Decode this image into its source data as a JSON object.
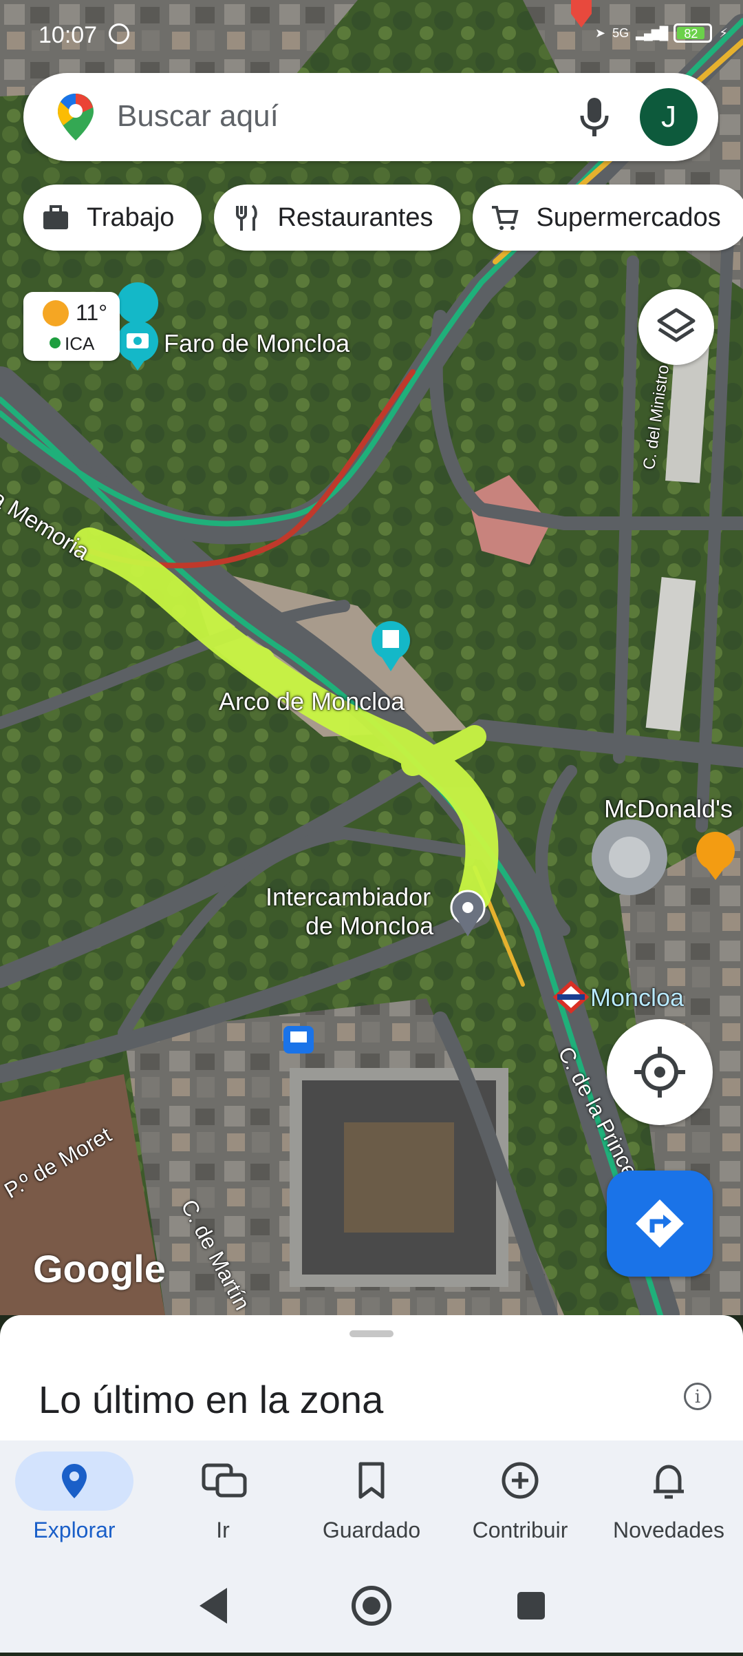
{
  "status_bar": {
    "time": "10:07",
    "network": "5G",
    "battery": "82"
  },
  "search": {
    "placeholder": "Buscar aquí",
    "avatar_letter": "J"
  },
  "chips": [
    {
      "label": "Trabajo",
      "icon": "briefcase-icon"
    },
    {
      "label": "Restaurantes",
      "icon": "fork-knife-icon"
    },
    {
      "label": "Supermercados",
      "icon": "cart-icon"
    }
  ],
  "weather": {
    "temp": "11°",
    "label": "ICA"
  },
  "map_labels": {
    "faro": "Faro de Moncloa",
    "memoria": "la Memoria",
    "arco": "Arco de Moncloa",
    "intercambiador_1": "Intercambiador",
    "intercambiador_2": "de Moncloa",
    "mcdonalds": "McDonald's",
    "metro": "Moncloa",
    "ministro": "C. del Ministro Ibáñez",
    "princesa": "C. de la Princesa",
    "moret": "P.º de Moret",
    "martin": "C. de Martín",
    "google": "Google"
  },
  "sheet": {
    "title": "Lo último en la zona"
  },
  "bottom_nav": [
    {
      "label": "Explorar",
      "icon": "pin-icon",
      "active": true
    },
    {
      "label": "Ir",
      "icon": "commute-icon",
      "active": false
    },
    {
      "label": "Guardado",
      "icon": "bookmark-icon",
      "active": false
    },
    {
      "label": "Contribuir",
      "icon": "plus-circle-icon",
      "active": false
    },
    {
      "label": "Novedades",
      "icon": "bell-icon",
      "active": false
    }
  ],
  "colors": {
    "accent": "#1a73e8",
    "highlight": "#c8f542",
    "traffic_green": "#1fb07a",
    "traffic_red": "#c0392b"
  }
}
